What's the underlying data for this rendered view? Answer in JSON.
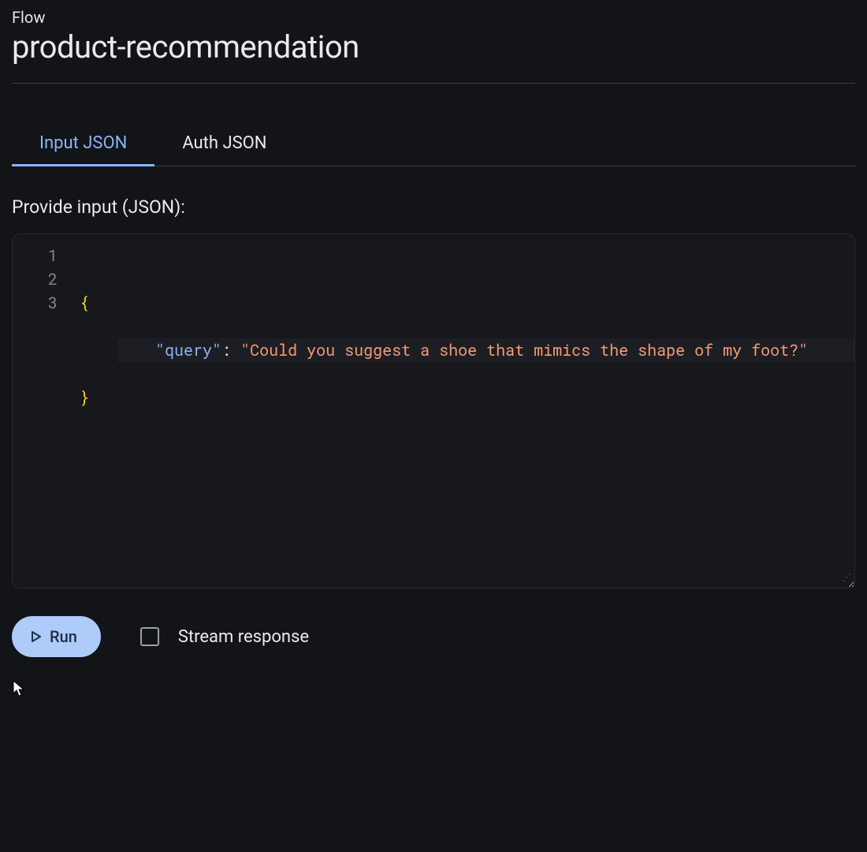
{
  "header": {
    "label": "Flow",
    "title": "product-recommendation"
  },
  "tabs": [
    {
      "label": "Input JSON",
      "active": true
    },
    {
      "label": "Auth JSON",
      "active": false
    }
  ],
  "input_section": {
    "label": "Provide input (JSON):"
  },
  "code": {
    "line_numbers": [
      "1",
      "2",
      "3"
    ],
    "line1_brace": "{",
    "line2_key": "\"query\"",
    "line2_colon": ": ",
    "line2_value": "\"Could you suggest a shoe that mimics the shape of my foot?\"",
    "line3_brace": "}"
  },
  "controls": {
    "run_label": "Run",
    "stream_label": "Stream response",
    "stream_checked": false
  }
}
